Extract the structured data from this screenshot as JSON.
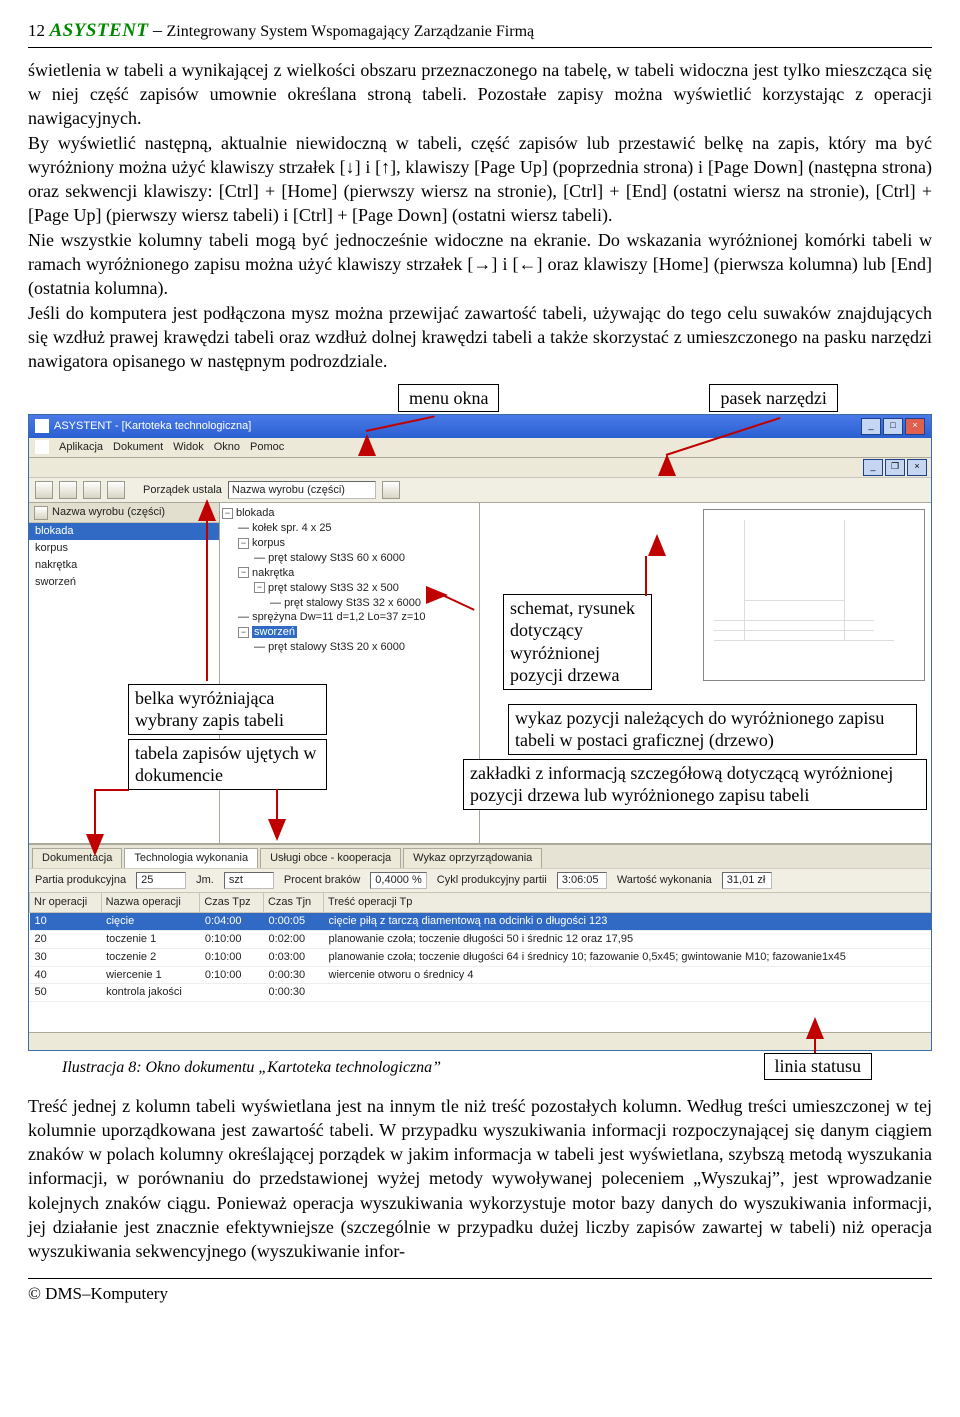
{
  "header": {
    "page_number": "12",
    "product": "ASYSTENT",
    "dash": "–",
    "subtitle": "Zintegrowany System Wspomagający Zarządzanie Firmą"
  },
  "body_text_1": "świetlenia w tabeli a wynikającej z wielkości obszaru przeznaczonego na tabelę, w tabeli widoczna jest tylko mieszcząca się w niej część zapisów umownie określana stroną tabeli. Pozostałe zapisy można wyświetlić korzystając z operacji nawigacyjnych.\nBy wyświetlić następną, aktualnie niewidoczną w tabeli, część zapisów lub przestawić belkę na zapis, który ma być wyróżniony można użyć klawiszy strzałek [↓] i [↑], klawiszy [Page Up] (poprzednia strona) i [Page Down] (następna strona) oraz sekwencji klawiszy: [Ctrl] + [Home] (pierwszy wiersz na stronie), [Ctrl] + [End] (ostatni wiersz na stronie), [Ctrl] + [Page Up] (pierwszy wiersz tabeli) i [Ctrl] + [Page Down] (ostatni wiersz tabeli).\nNie wszystkie kolumny tabeli mogą być jednocześnie widoczne na ekranie. Do wskazania wyróżnionej komórki tabeli w ramach wyróżnionego zapisu można użyć klawiszy strzałek [→] i [←] oraz klawiszy [Home] (pierwsza kolumna) lub [End] (ostatnia kolumna).\nJeśli do komputera jest podłączona mysz można przewijać zawartość tabeli, używając do tego celu suwaków znajdujących się wzdłuż prawej krawędzi tabeli oraz wzdłuż dolnej krawędzi tabeli a także skorzystać z umieszczonego na pasku narzędzi nawigatora opisanego w następnym podrozdziale.",
  "top_callouts": {
    "menu": "menu okna",
    "toolbar": "pasek narzędzi"
  },
  "app": {
    "title": "ASYSTENT - [Kartoteka technologiczna]",
    "menu_items": [
      "Aplikacja",
      "Dokument",
      "Widok",
      "Okno",
      "Pomoc"
    ],
    "toolbar_label_a": "Porządek ustala",
    "toolbar_field_a": "Nazwa wyrobu (części)",
    "left_header": "Nazwa wyrobu (części)",
    "left_list": [
      "blokada",
      "korpus",
      "nakrętka",
      "sworzeń"
    ],
    "left_selected": 0,
    "tree": {
      "root": "blokada",
      "items": [
        "kołek spr. 4 x 25",
        "korpus",
        "pręt stalowy St3S 60 x 6000",
        "nakrętka",
        "pręt stalowy St3S 32 x 500",
        "pręt stalowy St3S 32 x 6000",
        "sprężyna Dw=11 d=1,2 Lo=37 z=10",
        "sworzeń",
        "pręt stalowy St3S 20 x 6000"
      ],
      "selected_index": 7
    },
    "tabs": [
      "Dokumentacja",
      "Technologia wykonania",
      "Usługi obce - kooperacja",
      "Wykaz oprzyrządowania"
    ],
    "tabs_active": 1,
    "detail": {
      "batch_label": "Partia produkcyjna",
      "batch_value": "25",
      "unit_label": "Jm.",
      "unit_value": "szt",
      "reject_label": "Procent braków",
      "reject_value": "0,4000 %",
      "cycle_label": "Cykl produkcyjny partii",
      "cycle_value": "3:06:05",
      "value_label": "Wartość wykonania",
      "value_value": "31,01 zł"
    },
    "ops_headers": [
      "Nr operacji",
      "Nazwa operacji",
      "Czas Tpz",
      "Czas Tjn",
      "Treść operacji Tp"
    ],
    "ops_rows": [
      [
        "10",
        "cięcie",
        "0:04:00",
        "0:00:05",
        "cięcie piłą z tarczą diamentową na odcinki o długości 123"
      ],
      [
        "20",
        "toczenie 1",
        "0:10:00",
        "0:02:00",
        "planowanie czoła; toczenie długości 50 i średnic 12 oraz 17,95"
      ],
      [
        "30",
        "toczenie 2",
        "0:10:00",
        "0:03:00",
        "planowanie czoła; toczenie długości 64 i średnicy 10; fazowanie 0,5x45; gwintowanie M10; fazowanie1x45"
      ],
      [
        "40",
        "wiercenie 1",
        "0:10:00",
        "0:00:30",
        "wiercenie otworu o średnicy 4"
      ],
      [
        "50",
        "kontrola jakości",
        "",
        "0:00:30",
        ""
      ]
    ],
    "ops_selected": 0
  },
  "overlay": {
    "belka": "belka wyróżniająca wybrany zapis tabeli",
    "tabela": "tabela zapisów ujętych w dokumencie",
    "schemat": "schemat, rysunek dotyczący wyróżnionej pozycji drzewa",
    "wykaz": "wykaz pozycji należących do wyróżnionego zapisu tabeli w postaci graficznej (drzewo)",
    "zakladki": "zakładki z informacją szczegółową dotyczącą wyróżnionej pozycji drzewa lub wyróżnionego zapisu tabeli"
  },
  "caption": "Ilustracja 8: Okno dokumentu „Kartoteka technologiczna”",
  "status_callout": "linia statusu",
  "body_text_2": "Treść jednej z kolumn tabeli wyświetlana jest na innym tle niż treść pozostałych kolumn. Według treści umieszczonej w tej kolumnie uporządkowana jest zawartość tabeli. W przypadku wyszukiwania informacji rozpoczynającej się danym ciągiem znaków w polach kolumny określającej porządek w jakim informacja w tabeli jest wyświetlana, szybszą metodą wyszukania informacji, w porównaniu do przedstawionej wyżej metody wywoływanej poleceniem „Wyszukaj”, jest wprowadzanie kolejnych znaków ciągu. Ponieważ operacja wyszukiwania wykorzystuje motor bazy danych do wyszukiwania informacji, jej działanie jest znacznie efektywniejsze (szczególnie w przypadku dużej liczby zapisów zawartej w tabeli) niż operacja wyszukiwania sekwencyjnego (wyszukiwanie infor-",
  "footer": "© DMS–Komputery"
}
